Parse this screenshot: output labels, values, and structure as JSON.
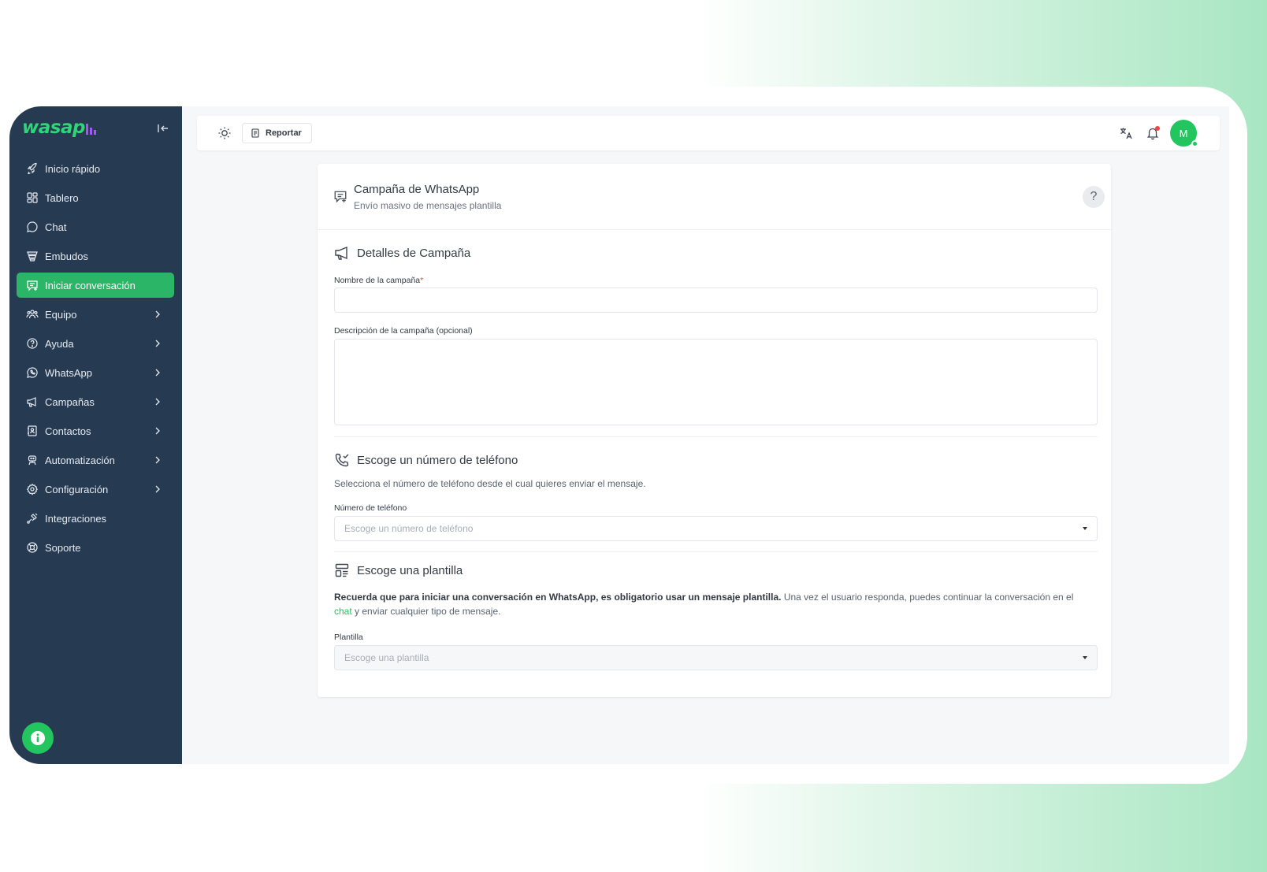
{
  "app": {
    "logo": "wasap",
    "brand_color": "#2fd576"
  },
  "sidebar": {
    "items": [
      {
        "label": "Inicio rápido",
        "icon": "rocket-icon",
        "chevron": false
      },
      {
        "label": "Tablero",
        "icon": "dashboard-icon",
        "chevron": false
      },
      {
        "label": "Chat",
        "icon": "chat-bubble-icon",
        "chevron": false
      },
      {
        "label": "Embudos",
        "icon": "funnel-icon",
        "chevron": false
      },
      {
        "label": "Iniciar conversación",
        "icon": "message-plus-icon",
        "chevron": false,
        "active": true
      },
      {
        "label": "Equipo",
        "icon": "team-icon",
        "chevron": true
      },
      {
        "label": "Ayuda",
        "icon": "help-circle-icon",
        "chevron": true
      },
      {
        "label": "WhatsApp",
        "icon": "whatsapp-icon",
        "chevron": true
      },
      {
        "label": "Campañas",
        "icon": "megaphone-icon",
        "chevron": true
      },
      {
        "label": "Contactos",
        "icon": "contacts-icon",
        "chevron": true
      },
      {
        "label": "Automatización",
        "icon": "robot-icon",
        "chevron": true
      },
      {
        "label": "Configuración",
        "icon": "gear-icon",
        "chevron": true
      },
      {
        "label": "Integraciones",
        "icon": "plug-icon",
        "chevron": false
      },
      {
        "label": "Soporte",
        "icon": "lifebuoy-icon",
        "chevron": false
      }
    ]
  },
  "topbar": {
    "report_label": "Reportar",
    "avatar_initial": "M"
  },
  "card": {
    "title": "Campaña de WhatsApp",
    "subtitle": "Envío masivo de mensajes plantilla",
    "help": "?",
    "details": {
      "title": "Detalles de Campaña",
      "name_label": "Nombre de la campaña",
      "required_mark": "*",
      "description_label": "Descripción de la campaña (opcional)"
    },
    "phone": {
      "title": "Escoge un número de teléfono",
      "help_text": "Selecciona el número de teléfono desde el cual quieres enviar el mensaje.",
      "field_label": "Número de teléfono",
      "placeholder": "Escoge un número de teléfono"
    },
    "template": {
      "title": "Escoge una plantilla",
      "notice_bold": "Recuerda que para iniciar una conversación en WhatsApp, es obligatorio usar un mensaje plantilla.",
      "notice_rest": " Una vez el usuario responda, puedes continuar la conversación en el ",
      "notice_link": "chat",
      "notice_end": " y enviar cualquier tipo de mensaje.",
      "field_label": "Plantilla",
      "placeholder": "Escoge una plantilla"
    }
  }
}
